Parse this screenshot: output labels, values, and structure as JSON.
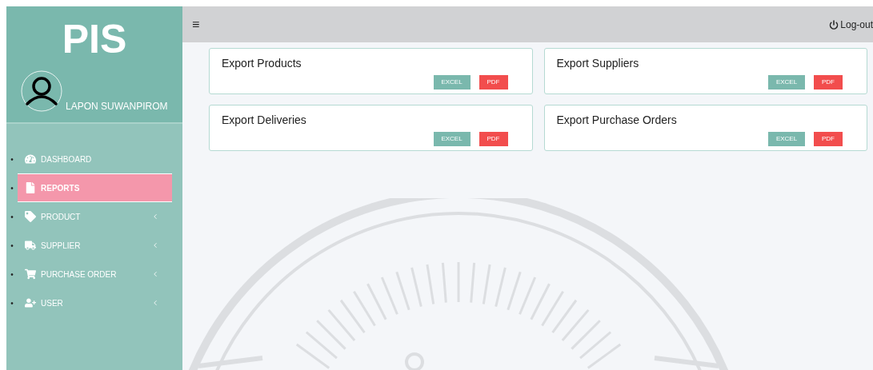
{
  "sidebar": {
    "brand": "PIS",
    "user_name": "LAPON SUWANPIROM",
    "items": [
      {
        "label": "DASHBOARD",
        "bullet": "•",
        "selected": false,
        "has_submenu": false
      },
      {
        "label": "REPORTS",
        "bullet": "•",
        "selected": true,
        "has_submenu": false
      },
      {
        "label": "PRODUCT",
        "bullet": "•",
        "selected": false,
        "has_submenu": true
      },
      {
        "label": "SUPPLIER",
        "bullet": "•",
        "selected": false,
        "has_submenu": true
      },
      {
        "label": "PURCHASE ORDER",
        "bullet": "•",
        "selected": false,
        "has_submenu": true
      },
      {
        "label": "USER",
        "bullet": "•",
        "selected": false,
        "has_submenu": true
      }
    ]
  },
  "header": {
    "menu_glyph": "≡",
    "logout": "Log-out"
  },
  "cards": [
    {
      "title": "Export Products",
      "buttons": [
        "EXCEL",
        "PDF"
      ]
    },
    {
      "title": "Export Suppliers",
      "buttons": [
        "EXCEL",
        "PDF"
      ]
    },
    {
      "title": "Export Deliveries",
      "buttons": [
        "EXCEL",
        "PDF"
      ]
    },
    {
      "title": "Export Purchase Orders",
      "buttons": [
        "EXCEL",
        "PDF"
      ]
    }
  ]
}
